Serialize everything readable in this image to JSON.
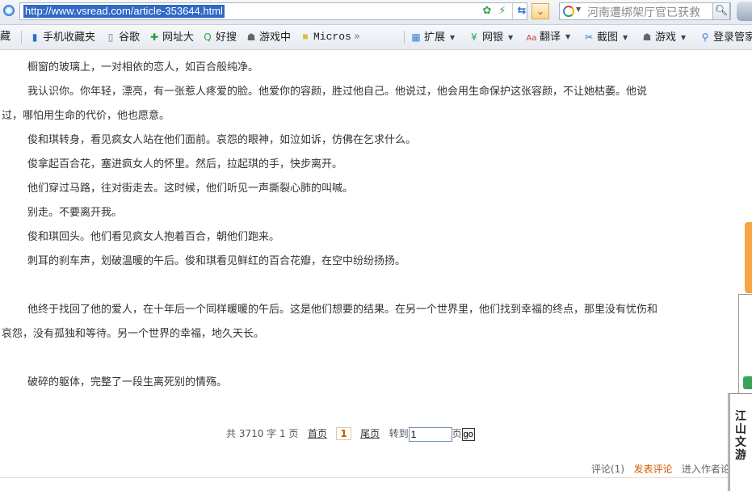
{
  "address_bar": {
    "url": "http://www.vsread.com/article-353644.html",
    "search_text": "河南遭绑架厅官已获救"
  },
  "favorites_bar": {
    "items": [
      {
        "label": "藏",
        "icon": "star-icon"
      },
      {
        "label": "手机收藏夹",
        "icon": "phone-icon"
      },
      {
        "label": "谷歌",
        "icon": "page-icon"
      },
      {
        "label": "网址大",
        "icon": "globe-icon"
      },
      {
        "label": "好搜",
        "icon": "search-icon"
      },
      {
        "label": "游戏中",
        "icon": "gamepad-icon"
      },
      {
        "label": "Micros",
        "icon": "folder-icon"
      },
      {
        "label": "扩展",
        "icon": "extensions-icon"
      },
      {
        "label": "网银",
        "icon": "bank-icon"
      },
      {
        "label": "翻译",
        "icon": "translate-icon"
      },
      {
        "label": "截图",
        "icon": "scissors-icon"
      },
      {
        "label": "游戏",
        "icon": "games-icon"
      },
      {
        "label": "登录管家",
        "icon": "login-icon"
      }
    ]
  },
  "article": {
    "paragraphs": [
      "橱窗的玻璃上，一对相依的恋人，如百合般纯净。",
      "我认识你。你年轻，漂亮，有一张惹人疼爱的脸。他爱你的容颜，胜过他自己。他说过，他会用生命保护这张容颜，不让她枯萎。他说",
      "过，哪怕用生命的代价，他也愿意。",
      "俊和琪转身，看见疯女人站在他们面前。哀怨的眼神，如泣如诉，仿佛在乞求什么。",
      "俊拿起百合花，塞进疯女人的怀里。然后，拉起琪的手，快步离开。",
      "他们穿过马路，往对街走去。这时候，他们听见一声撕裂心肺的叫喊。",
      "别走。不要离开我。",
      "俊和琪回头。他们看见疯女人抱着百合，朝他们跑来。",
      "刺耳的刹车声，划破温暖的午后。俊和琪看见鲜红的百合花瓣，在空中纷纷扬扬。",
      "他终于找回了他的爱人，在十年后一个同样暖暖的午后。这是他们想要的结果。在另一个世界里，他们找到幸福的终点，那里没有忧伤和",
      "哀怨，没有孤独和等待。另一个世界的幸福，地久天长。",
      "破碎的躯体，完整了一段生离死别的情殇。"
    ]
  },
  "pager": {
    "summary": "共 3710 字 1 页",
    "first_page": "首页",
    "current_page": "1",
    "last_page": "尾页",
    "goto_label": "转到",
    "goto_value": "1",
    "page_suffix": "页",
    "go_button": "go"
  },
  "comments": {
    "count_label": "评论(1)",
    "post_label": "发表评论",
    "author_label": "进入作者论"
  },
  "side_widget": {
    "label": "江山文游"
  }
}
